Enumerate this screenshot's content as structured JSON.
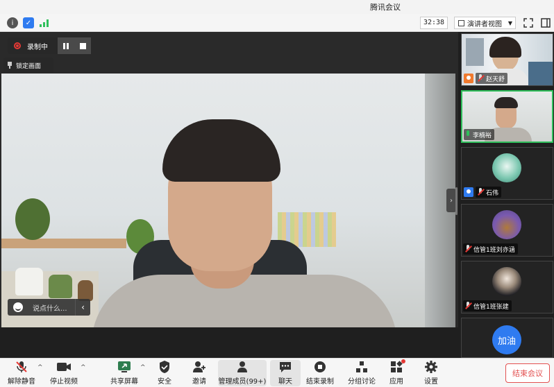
{
  "window": {
    "title": "腾讯会议"
  },
  "infobar": {
    "timer": "32:38",
    "view_mode": "演讲者视图",
    "icons": [
      "info-icon",
      "shield-icon",
      "signal-icon"
    ]
  },
  "recording": {
    "label": "录制中"
  },
  "lock_view": {
    "label": "锁定画面"
  },
  "chat": {
    "placeholder": "说点什么..."
  },
  "participants": [
    {
      "name": "赵天舒",
      "muted": true,
      "video": true
    },
    {
      "name": "李楠裕",
      "muted": false,
      "video": true,
      "speaking": true
    },
    {
      "name": "石伟",
      "muted": true,
      "video": false
    },
    {
      "name": "信管1班刘亦涵",
      "muted": true,
      "video": false
    },
    {
      "name": "信管1班张建",
      "muted": true,
      "video": false
    },
    {
      "name": "加油",
      "muted": true,
      "video": false
    }
  ],
  "toolbar": {
    "unmute": "解除静音",
    "stop_video": "停止视频",
    "share_screen": "共享屏幕",
    "security": "安全",
    "invite": "邀请",
    "manage_members": "管理成员(99+)",
    "chat": "聊天",
    "end_recording": "结束录制",
    "breakout": "分组讨论",
    "apps": "应用",
    "settings": "设置",
    "end_meeting": "结束会议"
  },
  "colors": {
    "end_red": "#e35050",
    "speaking_green": "#2fbf5b",
    "record_red": "#e53935"
  }
}
